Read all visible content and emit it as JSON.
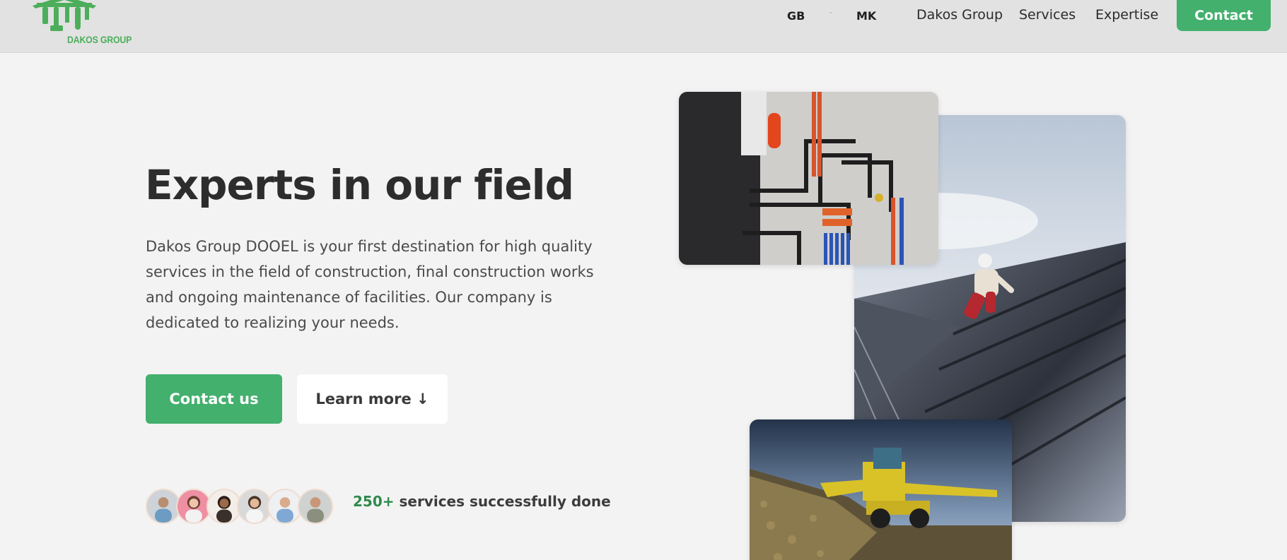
{
  "header": {
    "logo_text": "DAKOS GROUP",
    "languages": [
      "GB",
      "MK"
    ],
    "language_separator": "-",
    "nav": [
      "Dakos Group",
      "Services",
      "Expertise"
    ],
    "contact_label": "Contact"
  },
  "hero": {
    "title": "Experts in our field",
    "description": "Dakos Group DOOEL is your first destination for high quality services in the field of construction, final construction works and ongoing maintenance of facilities. Our company is dedicated to realizing your needs.",
    "primary_button": "Contact us",
    "secondary_button": "Learn more ↓",
    "stat_number": "250+",
    "stat_text": " services successfully done"
  },
  "colors": {
    "accent": "#43b06d",
    "logo_green": "#4cae5a",
    "header_bg": "#e2e2e2",
    "page_bg": "#f3f3f3"
  },
  "images": [
    "plumbing-manifold-photo",
    "roofer-on-metal-roof-photo",
    "beet-harvester-photo"
  ]
}
